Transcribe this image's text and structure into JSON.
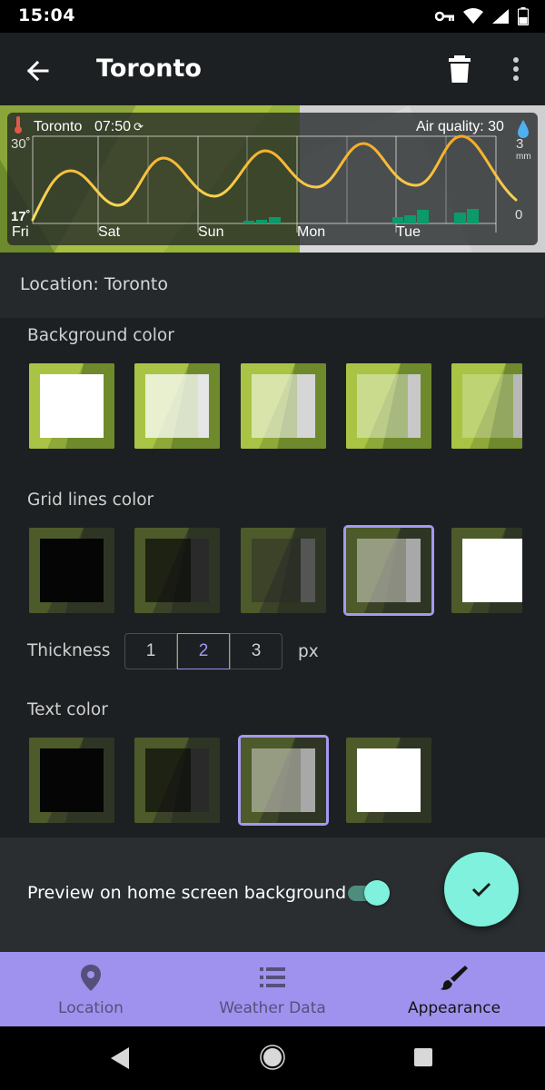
{
  "status_bar": {
    "time": "15:04",
    "icons": [
      "key-icon",
      "wifi-icon",
      "signal-icon",
      "battery-icon"
    ]
  },
  "app_bar": {
    "title": "Toronto",
    "back_icon": "arrow-back-icon",
    "delete_icon": "trash-icon",
    "menu_icon": "more-vert-icon"
  },
  "widget": {
    "city": "Toronto",
    "time": "07:50",
    "air_quality": "Air quality: 30",
    "temp_max": "30˚",
    "temp_min": "17˚",
    "precip_max": "3",
    "precip_unit": "mm",
    "precip_min": "0",
    "days": [
      "Fri",
      "Sat",
      "Sun",
      "Mon",
      "Tue"
    ]
  },
  "location_row": {
    "label": "Location: Toronto"
  },
  "background_color": {
    "label": "Background color",
    "selected_index": null
  },
  "grid_lines_color": {
    "label": "Grid lines color",
    "selected_index": 3
  },
  "thickness": {
    "label": "Thickness",
    "options": [
      "1",
      "2",
      "3"
    ],
    "selected": "2",
    "unit": "px"
  },
  "text_color": {
    "label": "Text color",
    "selected_index": 2
  },
  "preview": {
    "label": "Preview on home screen background",
    "enabled": true
  },
  "fab": {
    "icon": "check-icon"
  },
  "bottom_nav": {
    "items": [
      {
        "label": "Location",
        "icon": "location-pin-icon"
      },
      {
        "label": "Weather Data",
        "icon": "list-icon"
      },
      {
        "label": "Appearance",
        "icon": "brush-icon"
      }
    ],
    "active": "Appearance"
  },
  "colors": {
    "accent": "#9f92ee",
    "fab": "#7ff1dc",
    "selected_border": "#a698f0",
    "temp_curve": "#f0c020",
    "precip_bar": "#0b9a6a"
  }
}
